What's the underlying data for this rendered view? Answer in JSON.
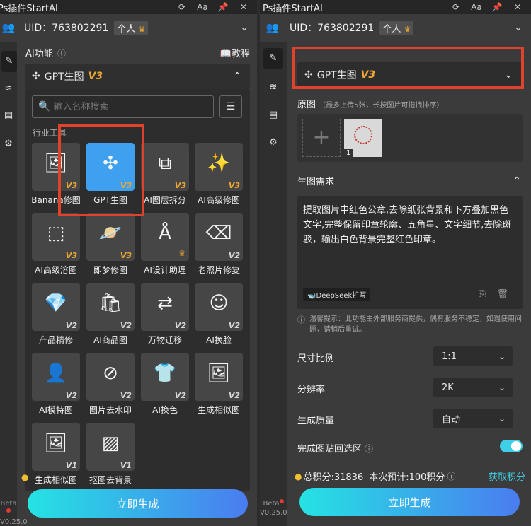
{
  "left": {
    "window_title": "Ps插件StartAI",
    "uid_label": "UID：763802291",
    "account_badge": "个人",
    "section_title": "AI功能",
    "tutorial_label": "教程",
    "selected_feature": "GPT生图",
    "selected_version": "V3",
    "search_placeholder": "输入名称搜索",
    "category_label": "行业工具",
    "features": [
      {
        "name": "Banana修图",
        "version": "V3",
        "icon": "image-icon"
      },
      {
        "name": "GPT生图",
        "version": "V3",
        "icon": "gpt-knot-icon"
      },
      {
        "name": "AI图层拆分",
        "version": "V3",
        "icon": "layers-split-icon"
      },
      {
        "name": "AI高级修图",
        "version": "V3",
        "icon": "magic-wand-icon"
      },
      {
        "name": "AI高级溶图",
        "version": "V3",
        "icon": "image-blend-icon"
      },
      {
        "name": "即梦修图",
        "version": "V3",
        "icon": "planet-brush-icon"
      },
      {
        "name": "AI设计助理",
        "version": "",
        "icon": "design-a-icon"
      },
      {
        "name": "老照片修复",
        "version": "V2",
        "icon": "eraser-icon"
      },
      {
        "name": "产品精修",
        "version": "V2",
        "icon": "diamond-icon"
      },
      {
        "name": "AI商品图",
        "version": "V2",
        "icon": "shopping-bag-icon"
      },
      {
        "name": "万物迁移",
        "version": "V2",
        "icon": "transfer-icon"
      },
      {
        "name": "AI换脸",
        "version": "V2",
        "icon": "face-swap-icon"
      },
      {
        "name": "AI模特图",
        "version": "V2",
        "icon": "model-person-icon"
      },
      {
        "name": "图片去水印",
        "version": "V2",
        "icon": "watermark-remove-icon"
      },
      {
        "name": "AI换色",
        "version": "V2",
        "icon": "palette-shirt-icon"
      },
      {
        "name": "生成相似图",
        "version": "V2",
        "icon": "similar-image-icon"
      },
      {
        "name": "生成相似图",
        "version": "V1",
        "icon": "similar-image-icon"
      },
      {
        "name": "抠图去背景",
        "version": "V1",
        "icon": "cutout-stripes-icon"
      }
    ],
    "generate_button": "立即生成",
    "beta_label": "Beta",
    "version_label": "V0.25.0"
  },
  "right": {
    "window_title": "Ps插件StartAI",
    "uid_label": "UID：763802291",
    "account_badge": "个人",
    "selected_feature": "GPT生图",
    "selected_version": "V3",
    "source_label": "原图",
    "source_hint": "（最多上传5张，长按图片可拖拽排序）",
    "thumb_index": "1",
    "prompt_section": "生图需求",
    "prompt_text": "提取图片中红色公章,去除纸张背景和下方叠加黑色文字,完整保留印章轮廓、五角星、文字细节,去除斑驳，输出白色背景完整红色印章。",
    "deepseek_label": "DeepSeek扩写",
    "notice_text": "温馨提示：此功能由外部服务商提供，偶有服务不稳定，如遇使用问题，请稍后重试。",
    "ratio_label": "尺寸比例",
    "ratio_value": "1:1",
    "resolution_label": "分辨率",
    "resolution_value": "2K",
    "quality_label": "生成质量",
    "quality_value": "自动",
    "paste_back_label": "完成图贴回选区",
    "paste_back_on": true,
    "points_text": "总积分:31836",
    "estimate_text": "本次预计:100积分",
    "get_points_label": "获取积分",
    "generate_button": "立即生成",
    "beta_label": "Beta",
    "version_label": "V0.25.0"
  },
  "colors": {
    "panel_bg": "#3b3b3b",
    "accent_cyan": "#25e3e3",
    "accent_blue": "#4a7cf0",
    "v3_badge": "#f0a830",
    "highlight_red": "#e0432b",
    "selected_tile": "#3fa0f0",
    "points_link": "#3fd0e8"
  }
}
